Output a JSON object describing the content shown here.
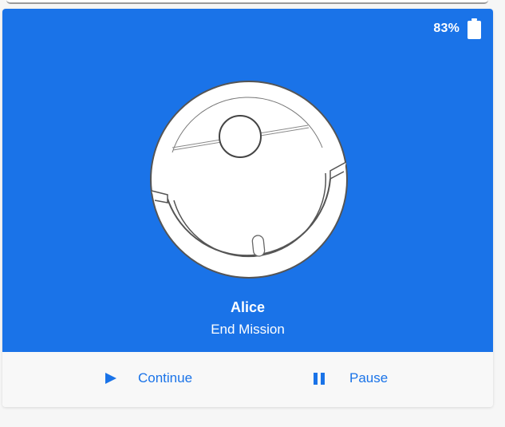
{
  "battery": {
    "level_text": "83%",
    "icon": "battery-icon"
  },
  "robot": {
    "name": "Alice",
    "status": "End Mission",
    "image": "robot-vacuum-illustration"
  },
  "actions": {
    "continue_label": "Continue",
    "continue_icon": "play-icon",
    "pause_label": "Pause",
    "pause_icon": "pause-icon"
  },
  "colors": {
    "accent": "#1a73e8",
    "hero_background": "#1a73e8",
    "action_bar": "#f8f8f8"
  }
}
